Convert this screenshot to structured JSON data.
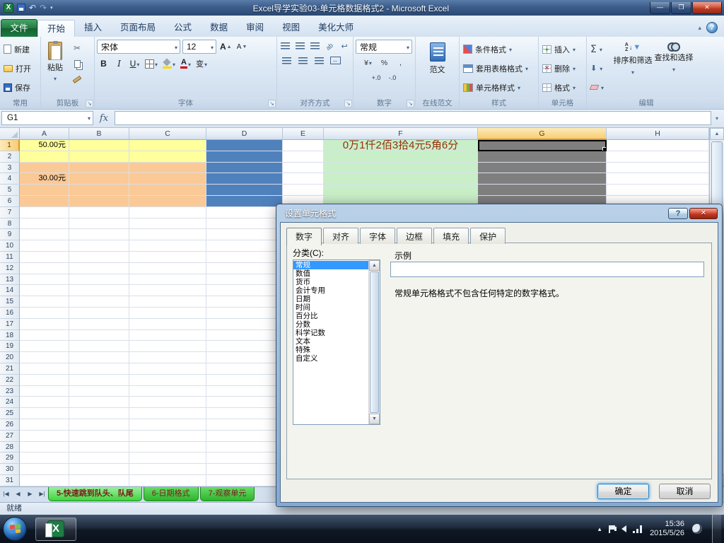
{
  "window": {
    "title": "Excel导学实验03-单元格数据格式2 - Microsoft Excel"
  },
  "ribbon": {
    "file_tab": "文件",
    "tabs": [
      "开始",
      "插入",
      "页面布局",
      "公式",
      "数据",
      "审阅",
      "视图",
      "美化大师"
    ],
    "active_tab_index": 0,
    "groups": {
      "common": {
        "label": "常用",
        "new": "新建",
        "open": "打开",
        "save": "保存"
      },
      "clipboard": {
        "label": "剪贴板",
        "paste": "粘贴"
      },
      "font": {
        "label": "字体",
        "name": "宋体",
        "size": "12",
        "bold": "B",
        "italic": "I",
        "underline": "U",
        "phonetic": "变"
      },
      "alignment": {
        "label": "对齐方式"
      },
      "number": {
        "label": "数字",
        "format": "常规",
        "currency": "¥",
        "percent": "%",
        "comma": ","
      },
      "online_doc": {
        "label": "在线范文",
        "button": "范文"
      },
      "styles": {
        "label": "样式",
        "conditional": "条件格式",
        "table_format": "套用表格格式",
        "cell_styles": "单元格样式"
      },
      "cells": {
        "label": "单元格",
        "insert": "插入",
        "delete": "删除",
        "format": "格式"
      },
      "editing": {
        "label": "编辑",
        "autosum": "Σ",
        "sort": "排序和筛选",
        "find": "查找和选择"
      }
    }
  },
  "formula_bar": {
    "name_box": "G1",
    "fx_label": "fx",
    "value": ""
  },
  "grid": {
    "columns": [
      [
        "A",
        70
      ],
      [
        "B",
        85
      ],
      [
        "C",
        109
      ],
      [
        "D",
        108
      ],
      [
        "E",
        58
      ],
      [
        "F",
        218
      ],
      [
        "G",
        182
      ],
      [
        "H",
        145
      ]
    ],
    "row_count": 31,
    "selected_col": "G",
    "selected_row": 1,
    "cells": [
      {
        "col": "A",
        "row": 1,
        "text": "50.00元",
        "align": "right",
        "color": "#000000",
        "size": 11
      },
      {
        "col": "A",
        "row": 4,
        "text": "30.00元",
        "align": "right",
        "color": "#000000",
        "size": 11
      },
      {
        "col": "F",
        "row": 1,
        "text": "0万1仟2佰3拾4元5角6分",
        "align": "center",
        "color": "#96310a",
        "size": 15
      }
    ],
    "fills": [
      {
        "cols": [
          "A",
          "B",
          "C"
        ],
        "rows": [
          1,
          2
        ],
        "color": "#ffff9c"
      },
      {
        "cols": [
          "A",
          "B",
          "C"
        ],
        "rows": [
          3,
          4,
          5,
          6
        ],
        "color": "#fbc995"
      },
      {
        "cols": [
          "D"
        ],
        "rows": [
          1,
          2,
          3,
          4,
          5,
          6
        ],
        "color": "#4f81bd"
      },
      {
        "cols": [
          "F"
        ],
        "rows": [
          1,
          2,
          3,
          4,
          5,
          6
        ],
        "color": "#c9efc9"
      },
      {
        "cols": [
          "G"
        ],
        "rows": [
          1,
          2,
          3,
          4,
          5,
          6
        ],
        "color": "#7f7f7f"
      }
    ]
  },
  "sheet_tabs": {
    "tabs": [
      "5-快速跳到队头、队尾",
      "6-日期格式",
      "7-观察单元"
    ],
    "active_index": 0
  },
  "status_bar": {
    "mode": "就绪"
  },
  "dialog": {
    "title": "设置单元格式",
    "tabs": [
      "数字",
      "对齐",
      "字体",
      "边框",
      "填充",
      "保护"
    ],
    "active_tab_index": 0,
    "category_label": "分类(C):",
    "categories": [
      "常规",
      "数值",
      "货币",
      "会计专用",
      "日期",
      "时间",
      "百分比",
      "分数",
      "科学记数",
      "文本",
      "特殊",
      "自定义"
    ],
    "selected_index": 0,
    "sample_label": "示例",
    "description": "常规单元格格式不包含任何特定的数字格式。",
    "ok_label": "确定",
    "cancel_label": "取消"
  },
  "taskbar": {
    "time": "15:36",
    "date": "2015/5/26"
  },
  "colors": {
    "selected_header": "#f7cd74",
    "file_tab_green": "#1d7a41",
    "sheet_tab_green": "#2db42d"
  }
}
